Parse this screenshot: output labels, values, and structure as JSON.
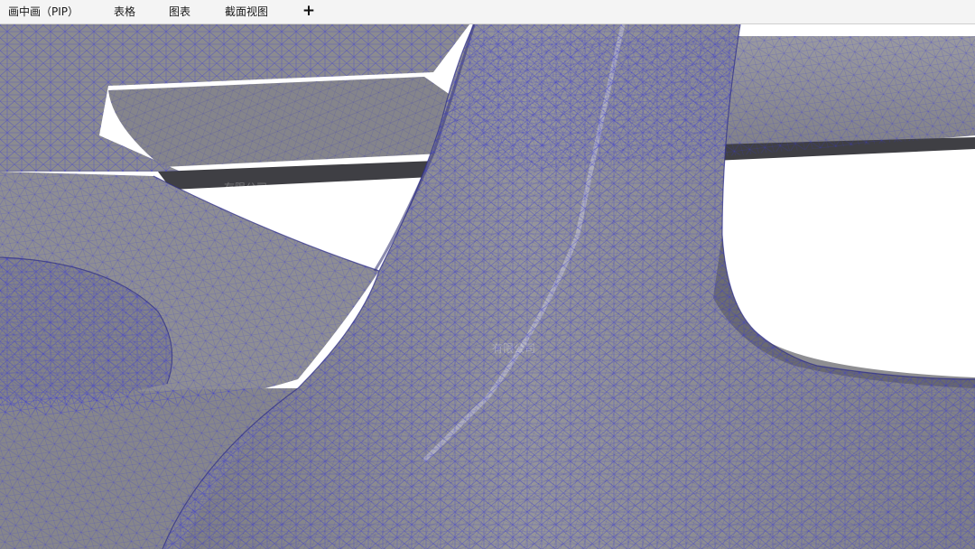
{
  "tabs": {
    "pip": "画中画（PIP）",
    "table": "表格",
    "chart": "图表",
    "section": "截面视图",
    "add": "+"
  },
  "viewport": {
    "background": "#ffffff",
    "surface_color": "#8c8c8f",
    "mesh_color": "#3a3ad6",
    "shadow_color": "#4a4a4e",
    "highlight_color": "#b4b4c8"
  },
  "watermarks": [
    "有限公司",
    "有限公司",
    "有限公司"
  ]
}
